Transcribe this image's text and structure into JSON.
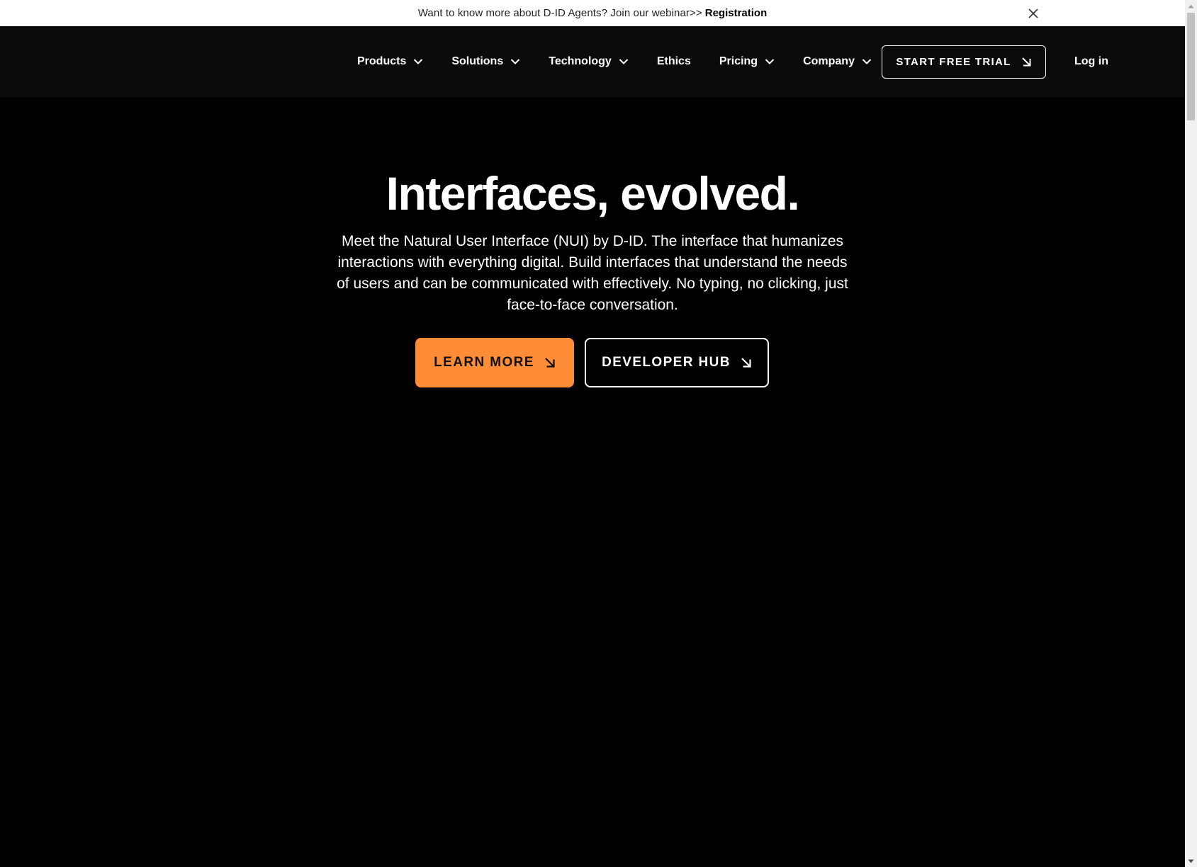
{
  "announcement": {
    "message": "Want to know more about D-ID Agents? Join our webinar>>",
    "link_label": "Registration",
    "close_icon": "close-icon"
  },
  "nav": {
    "items": [
      {
        "label": "Products",
        "has_dropdown": true
      },
      {
        "label": "Solutions",
        "has_dropdown": true
      },
      {
        "label": "Technology",
        "has_dropdown": true
      },
      {
        "label": "Ethics",
        "has_dropdown": false
      },
      {
        "label": "Pricing",
        "has_dropdown": true
      },
      {
        "label": "Company",
        "has_dropdown": true
      }
    ],
    "trial_label": "START FREE TRIAL",
    "login_label": "Log in"
  },
  "hero": {
    "title": "Interfaces, evolved.",
    "description": "Meet the Natural User Interface (NUI) by D-ID. The interface that humanizes interactions with everything digital. Build interfaces that understand the needs of users and can be communicated with effectively. No typing, no clicking, just face-to-face conversation.",
    "learn_more_label": "LEARN MORE",
    "developer_hub_label": "DEVELOPER HUB"
  },
  "colors": {
    "accent": "#ff8c37",
    "background": "#000000",
    "nav_background": "#0b0b0b",
    "announcement_background": "#ffffff"
  }
}
